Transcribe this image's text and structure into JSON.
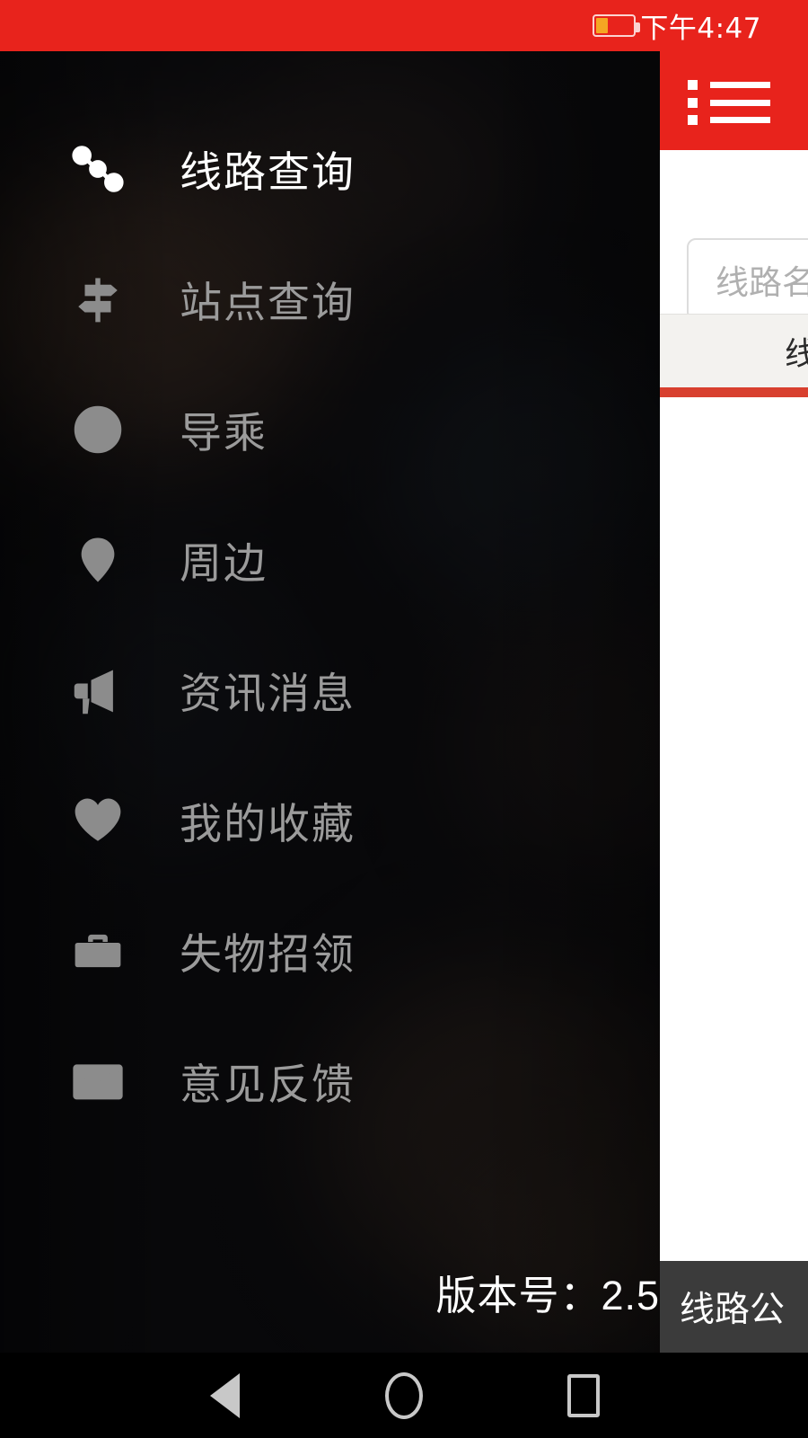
{
  "statusbar": {
    "time": "下午4:47",
    "battery_icon": "battery-icon",
    "battery_level_pct": 28
  },
  "app": {
    "header": {
      "menu_icon": "list-icon"
    },
    "search": {
      "placeholder": "线路名称",
      "value": ""
    },
    "tabs": [
      {
        "label": "线路"
      }
    ],
    "accent_color": "#e8231c",
    "tab_underline_color": "#d8402f",
    "tabbar_bg": "#f3f2ef"
  },
  "drawer": {
    "items": [
      {
        "label": "线路查询",
        "icon": "route-icon",
        "active": true
      },
      {
        "label": "站点查询",
        "icon": "signpost-icon",
        "active": false
      },
      {
        "label": "导乘",
        "icon": "compass-icon",
        "active": false
      },
      {
        "label": "周边",
        "icon": "map-pin-icon",
        "active": false
      },
      {
        "label": "资讯消息",
        "icon": "megaphone-icon",
        "active": false
      },
      {
        "label": "我的收藏",
        "icon": "heart-icon",
        "active": false
      },
      {
        "label": "失物招领",
        "icon": "briefcase-icon",
        "active": false
      },
      {
        "label": "意见反馈",
        "icon": "envelope-icon",
        "active": false
      }
    ],
    "version_text": "版本号：2.5",
    "active_text_color": "#ffffff",
    "inactive_text_color": "#9b9b9b"
  },
  "toast": {
    "text": "线路公"
  },
  "navbar": {
    "back": "back-triangle-icon",
    "home": "home-circle-icon",
    "recents": "recents-square-icon"
  }
}
